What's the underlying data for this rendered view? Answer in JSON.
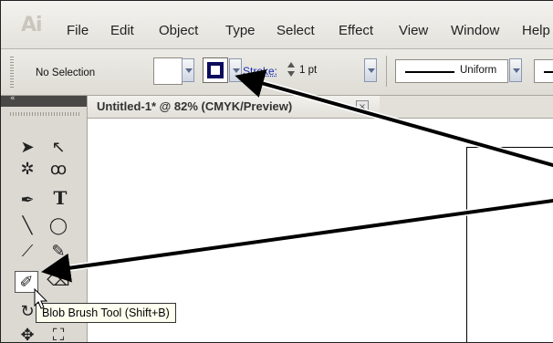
{
  "app": {
    "logo": "Ai"
  },
  "menu": [
    "File",
    "Edit",
    "Object",
    "Type",
    "Select",
    "Effect",
    "View",
    "Window",
    "Help"
  ],
  "control_bar": {
    "selection_status": "No Selection",
    "stroke_label": "Stroke:",
    "stroke_weight": "1 pt",
    "profile_label": "Uniform"
  },
  "tools_panel": {
    "collapse_glyph": "«"
  },
  "document": {
    "tab_title": "Untitled-1* @ 82% (CMYK/Preview)",
    "close_glyph": "×"
  },
  "tooltip": {
    "text": "Blob Brush Tool (Shift+B)"
  },
  "colors": {
    "stroke_swatch": "#0c0c5e",
    "annotation_arrow": "#000000",
    "tooltip_bg": "#fffff0"
  },
  "icons": {
    "tools": [
      "selection-tool-icon",
      "direct-selection-tool-icon",
      "magic-wand-tool-icon",
      "lasso-tool-icon",
      "pen-tool-icon",
      "type-tool-icon",
      "line-segment-tool-icon",
      "ellipse-tool-icon",
      "paintbrush-tool-icon",
      "pencil-tool-icon",
      "blob-brush-tool-icon",
      "eraser-tool-icon",
      "rotate-tool-icon",
      "warp-tool-icon",
      "free-transform-tool-icon"
    ]
  }
}
